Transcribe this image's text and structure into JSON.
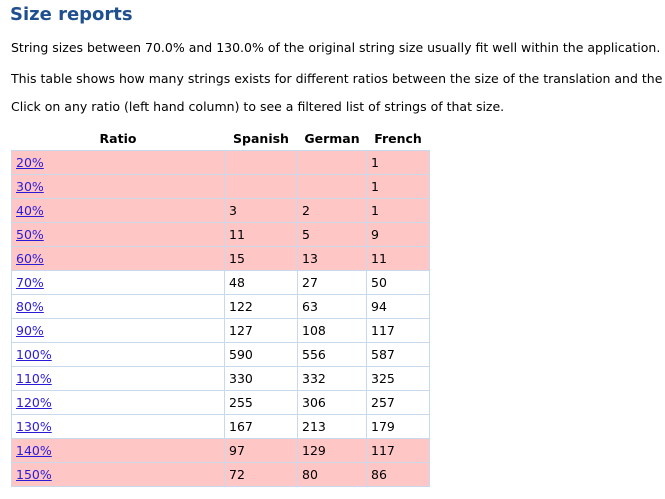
{
  "page": {
    "title": "Size reports",
    "intro": "String sizes between 70.0% and 130.0% of the original string size usually fit well within the application.",
    "description": "This table shows how many strings exists for different ratios between the size of the translation and the size of t",
    "instruction": "Click on any ratio (left hand column) to see a filtered list of strings of that size."
  },
  "table": {
    "headers": [
      "Ratio",
      "Spanish",
      "German",
      "French"
    ],
    "rows": [
      {
        "ratio": "20%",
        "es": "",
        "de": "",
        "fr": "1",
        "highlight": true
      },
      {
        "ratio": "30%",
        "es": "",
        "de": "",
        "fr": "1",
        "highlight": true
      },
      {
        "ratio": "40%",
        "es": "3",
        "de": "2",
        "fr": "1",
        "highlight": true
      },
      {
        "ratio": "50%",
        "es": "11",
        "de": "5",
        "fr": "9",
        "highlight": true
      },
      {
        "ratio": "60%",
        "es": "15",
        "de": "13",
        "fr": "11",
        "highlight": true
      },
      {
        "ratio": "70%",
        "es": "48",
        "de": "27",
        "fr": "50",
        "highlight": false
      },
      {
        "ratio": "80%",
        "es": "122",
        "de": "63",
        "fr": "94",
        "highlight": false
      },
      {
        "ratio": "90%",
        "es": "127",
        "de": "108",
        "fr": "117",
        "highlight": false
      },
      {
        "ratio": "100%",
        "es": "590",
        "de": "556",
        "fr": "587",
        "highlight": false
      },
      {
        "ratio": "110%",
        "es": "330",
        "de": "332",
        "fr": "325",
        "highlight": false
      },
      {
        "ratio": "120%",
        "es": "255",
        "de": "306",
        "fr": "257",
        "highlight": false
      },
      {
        "ratio": "130%",
        "es": "167",
        "de": "213",
        "fr": "179",
        "highlight": false
      },
      {
        "ratio": "140%",
        "es": "97",
        "de": "129",
        "fr": "117",
        "highlight": true
      },
      {
        "ratio": "150%",
        "es": "72",
        "de": "80",
        "fr": "86",
        "highlight": true
      }
    ]
  },
  "colors": {
    "title": "#1f4f8e",
    "highlight_row": "#ffc6c6",
    "normal_row": "#ffffff",
    "link": "#2b1bd6",
    "cell_border": "#c9d9ec"
  }
}
